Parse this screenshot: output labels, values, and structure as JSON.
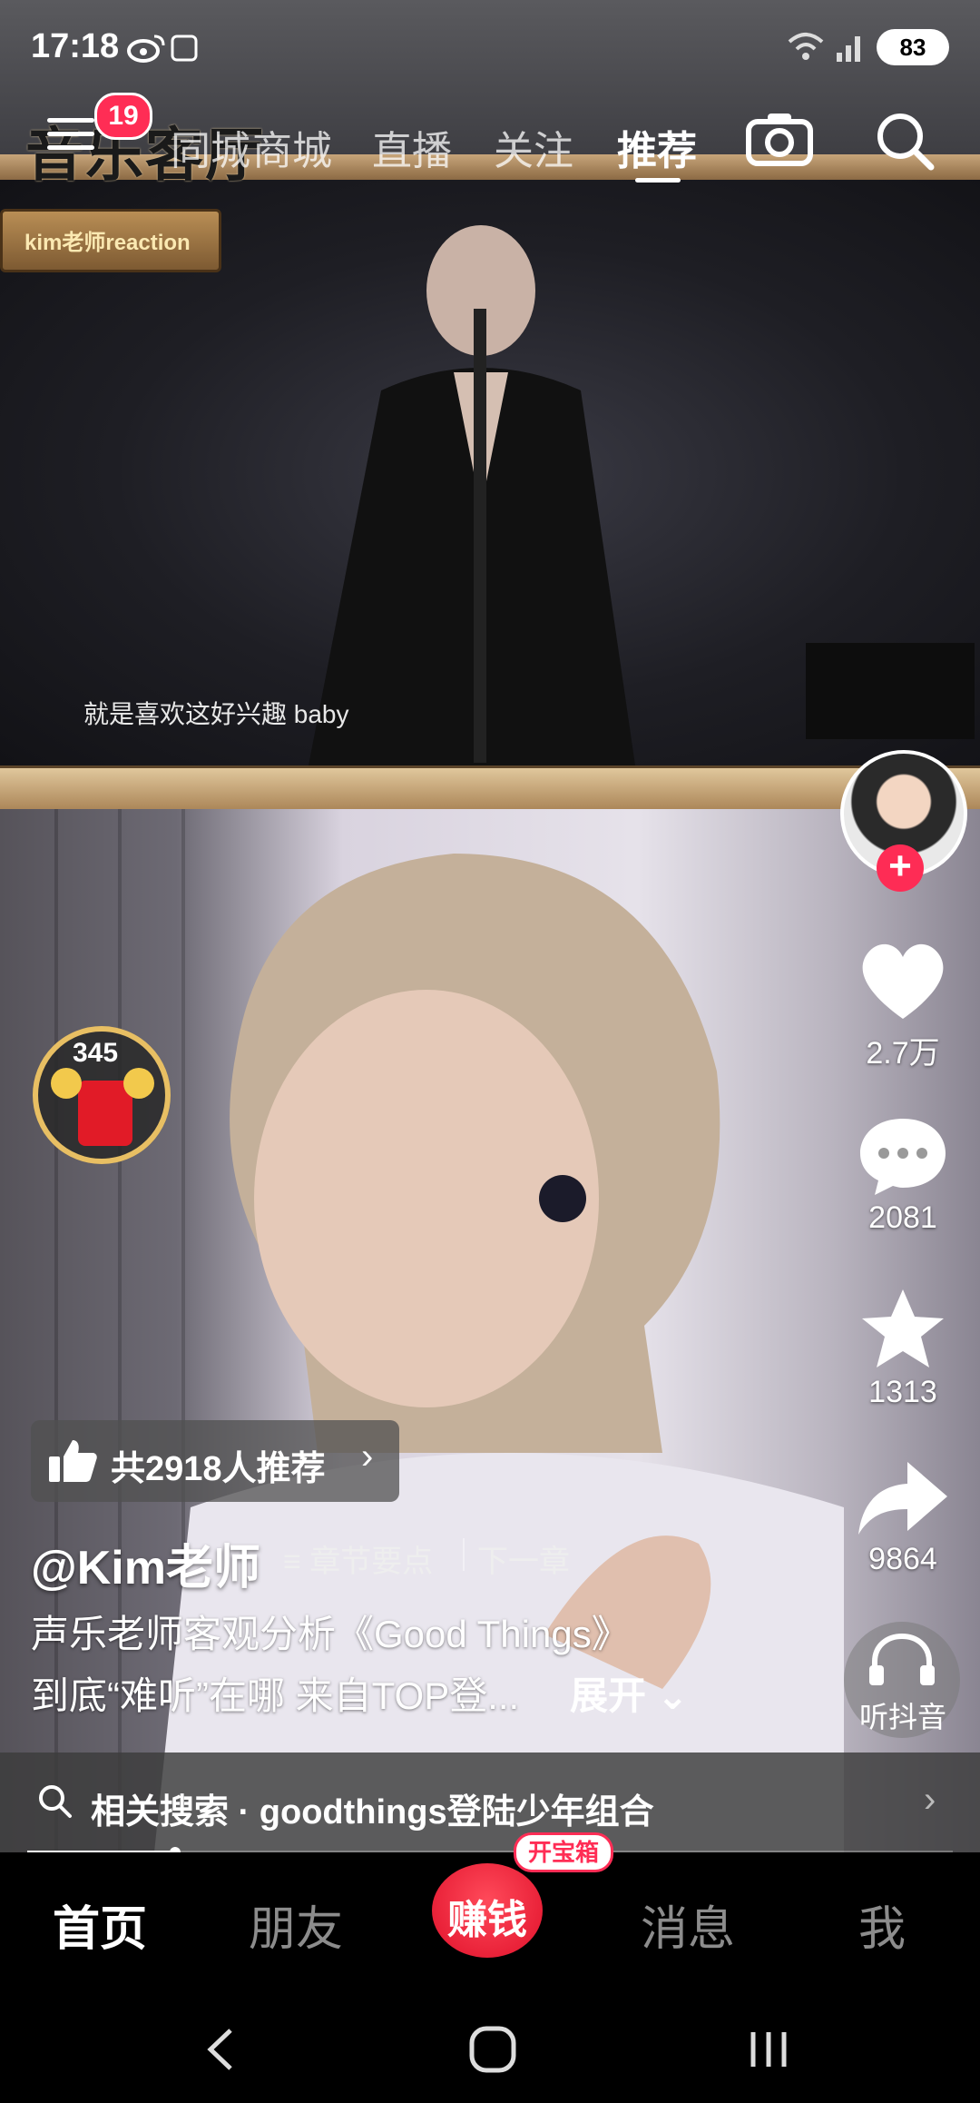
{
  "status_bar": {
    "time": "17:18",
    "battery": "83"
  },
  "top_nav": {
    "notification_count": "19",
    "tabs": [
      {
        "label": "同城",
        "active": false
      },
      {
        "label": "商城",
        "active": false
      },
      {
        "label": "直播",
        "active": false
      },
      {
        "label": "关注",
        "active": false
      },
      {
        "label": "推荐",
        "active": true
      }
    ]
  },
  "video": {
    "overlay_logo": "音乐客厅",
    "sign_text": "kim老师reaction",
    "subtitle": "就是喜欢这好兴趣  baby"
  },
  "sidebar": {
    "likes": "2.7万",
    "comments": "2081",
    "favorites": "1313",
    "shares": "9864",
    "listen_label": "听抖音"
  },
  "redpack": {
    "count": "345"
  },
  "recommend": {
    "text": "共2918人推荐"
  },
  "post": {
    "author": "@Kim老师",
    "chapter_key_label": "章节要点",
    "chapter_next_label": "下一章",
    "desc_line1": "声乐老师客观分析《Good Things》",
    "desc_line2": "到底“难听”在哪 来自TOP登...",
    "expand_label": "展开"
  },
  "related_search": {
    "text": "相关搜索 · goodthings登陆少年组合"
  },
  "progress": {
    "fraction": 0.16
  },
  "bottom_tabs": {
    "home": "首页",
    "friends": "朋友",
    "earn": "赚钱",
    "treasure_badge": "开宝箱",
    "messages": "消息",
    "me": "我"
  },
  "colors": {
    "accent": "#fe2c55",
    "gold": "#e8bf63"
  }
}
